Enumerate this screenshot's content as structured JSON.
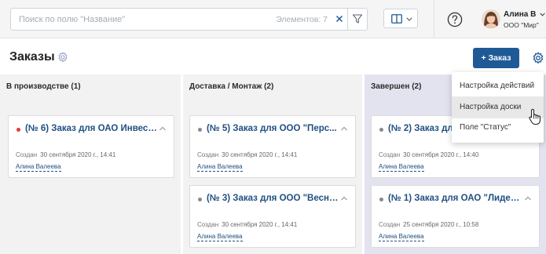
{
  "search": {
    "placeholder": "Поиск по полю \"Название\"",
    "count_label": "Элементов: 7"
  },
  "user": {
    "name": "Алина В",
    "org": "ООО \"Мир\""
  },
  "page": {
    "title": "Заказы",
    "add_button": "+ Заказ"
  },
  "columns": [
    {
      "title": "В производстве (1)",
      "cards": [
        {
          "title": "(№ 6) Заказ для ОАО Инвест...",
          "created_label": "Создан",
          "created": "30 сентября 2020 г., 14:41",
          "author": "Алина Валеева",
          "dot": "red"
        }
      ]
    },
    {
      "title": "Доставка / Монтаж (2)",
      "cards": [
        {
          "title": "(№ 5) Заказ для ООО \"Перс...",
          "created_label": "Создан",
          "created": "30 сентября 2020 г., 14:41",
          "author": "Алина Валеева",
          "dot": "grey"
        },
        {
          "title": "(№ 3) Заказ для ООО \"Весна...",
          "created_label": "Создан",
          "created": "30 сентября 2020 г., 14:41",
          "author": "Алина Валеева",
          "dot": "grey"
        }
      ]
    },
    {
      "title": "Завершен (2)",
      "cards": [
        {
          "title": "(№ 2) Заказ для",
          "created_label": "Создан",
          "created": "30 сентября 2020 г., 14:40",
          "author": "Алина Валеева",
          "dot": "grey"
        },
        {
          "title": "(№ 1) Заказ для ОАО \"Лидер...",
          "created_label": "Создан",
          "created": "25 сентября 2020 г., 10:58",
          "author": "Алина Валеева",
          "dot": "grey"
        }
      ]
    }
  ],
  "menu": {
    "items": [
      "Настройка действий",
      "Настройка доски",
      "Поле \"Статус\""
    ],
    "active_index": 1
  },
  "colors": {
    "accent": "#1f5a96",
    "link": "#1f4f82",
    "status_red": "#e53935"
  }
}
